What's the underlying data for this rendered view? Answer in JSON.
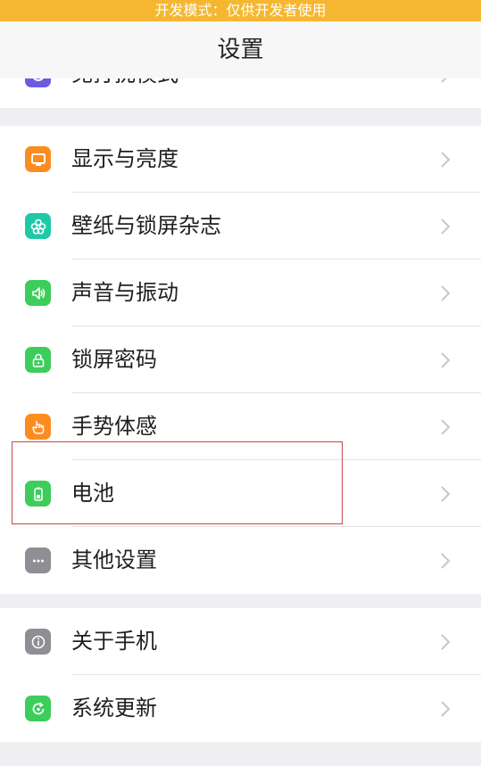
{
  "banner": {
    "text": "开发模式：仅供开发者使用"
  },
  "nav": {
    "title": "设置"
  },
  "top_partial": {
    "label": "免打扰模式"
  },
  "group1": [
    {
      "label": "显示与亮度",
      "icon": "display-icon",
      "color": "#fb8c20"
    },
    {
      "label": "壁纸与锁屏杂志",
      "icon": "wallpaper-flower-icon",
      "color": "#1fc9a7"
    },
    {
      "label": "声音与振动",
      "icon": "speaker-icon",
      "color": "#3ccd5b"
    },
    {
      "label": "锁屏密码",
      "icon": "lock-icon",
      "color": "#3ccd5b"
    },
    {
      "label": "手势体感",
      "icon": "hand-gesture-icon",
      "color": "#fb8c20"
    },
    {
      "label": "电池",
      "icon": "battery-icon",
      "color": "#3ccd5b"
    },
    {
      "label": "其他设置",
      "icon": "more-dots-icon",
      "color": "#8e8e95"
    }
  ],
  "group2": [
    {
      "label": "关于手机",
      "icon": "info-icon",
      "color": "#8e8e95"
    },
    {
      "label": "系统更新",
      "icon": "update-icon",
      "color": "#3ccd5b"
    }
  ],
  "colors": {
    "banner": "#f5b731",
    "highlight_border": "#c9474a"
  }
}
